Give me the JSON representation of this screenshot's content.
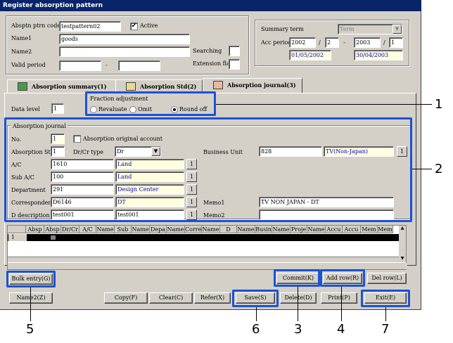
{
  "window": {
    "title": "Register absorption pattern"
  },
  "header": {
    "pattern_code_label": "Absptn ptrn code",
    "pattern_code_value": "testpattern02",
    "active_label": "Active",
    "active_checked": "✔",
    "name1_label": "Name1",
    "name1_value": "goods",
    "name2_label": "Name2",
    "name2_value": "",
    "valid_period_label": "Valid period",
    "valid_period_sep": "-",
    "searching_label": "Searching",
    "extension_flag_label": "Extension flag"
  },
  "summary": {
    "term_label": "Summary term",
    "term_value": "Term",
    "acc_period_label": "Acc period",
    "from_year": "2002",
    "from_month": "2",
    "to_year": "2003",
    "to_month": "1",
    "slash": "/",
    "dash": "-",
    "from_date": "01/05/2002",
    "to_date": "30/04/2003"
  },
  "tabs": [
    {
      "label": "Absorption summary(1)"
    },
    {
      "label": "Absorption Std(2)"
    },
    {
      "label": "Absorption journal(3)"
    }
  ],
  "data_level": {
    "label": "Data level",
    "value": "1"
  },
  "fraction": {
    "title": "Fraction adjustment",
    "options": [
      "Revaluate",
      "Omit",
      "Round off"
    ],
    "selected": "Round off"
  },
  "journal": {
    "title": "Absorption journal",
    "no_label": "No.",
    "no_value": "1",
    "orig_account_label": "Absorption original account",
    "std_label": "Absorption Std",
    "std_value": "1",
    "drcr_label": "Dr/Cr type",
    "drcr_value": "Dr",
    "business_unit_label": "Business Unit",
    "business_unit_value": "828",
    "business_unit_name": "TV(Non-Japan)",
    "ac_label": "A/C",
    "ac_value": "1610",
    "ac_name": "Land",
    "sub_ac_label": "Sub A/C",
    "sub_ac_value": "100",
    "sub_ac_name": "Land",
    "dept_label": "Department",
    "dept_value": "291",
    "dept_name": "Design Center",
    "corr_label": "Correspondent",
    "corr_value": "D6146",
    "corr_name": "DT",
    "desc_label": "D description",
    "desc_value": "test001",
    "desc_name": "test001",
    "memo1_label": "Memo1",
    "memo1_value": "TV NON JAPAN - DT",
    "memo2_label": "Memo2",
    "memo2_value": "",
    "lookup_label": "1"
  },
  "grid": {
    "columns": [
      "Absp",
      "Absp",
      "Dr/Cr",
      "A/C",
      "Name",
      "Sub",
      "Name",
      "Depa",
      "Name",
      "Corre",
      "Name",
      "D",
      "Name",
      "Busin",
      "Name",
      "Proje",
      "Name",
      "Accu",
      "Accu",
      "Mem",
      "Mem"
    ],
    "row_number": "1"
  },
  "buttons": {
    "bulk_entry": "Bulk entry(G)",
    "commit": "Commit(K)",
    "add_row": "Add row(R)",
    "del_row": "Del row(L)",
    "name2": "Name2(Z)",
    "copy": "Copy(F)",
    "clear": "Clear(C)",
    "refer": "Refer(X)",
    "save": "Save(S)",
    "delete": "Delete(D)",
    "print": "Print(P)",
    "exit": "Exit(E)"
  },
  "callouts": [
    "1",
    "2",
    "3",
    "4",
    "5",
    "6",
    "7"
  ],
  "colors": {
    "highlight": "#1a52d8",
    "titlebar": "#0a246a",
    "lookup_field": "#ffffe0"
  }
}
